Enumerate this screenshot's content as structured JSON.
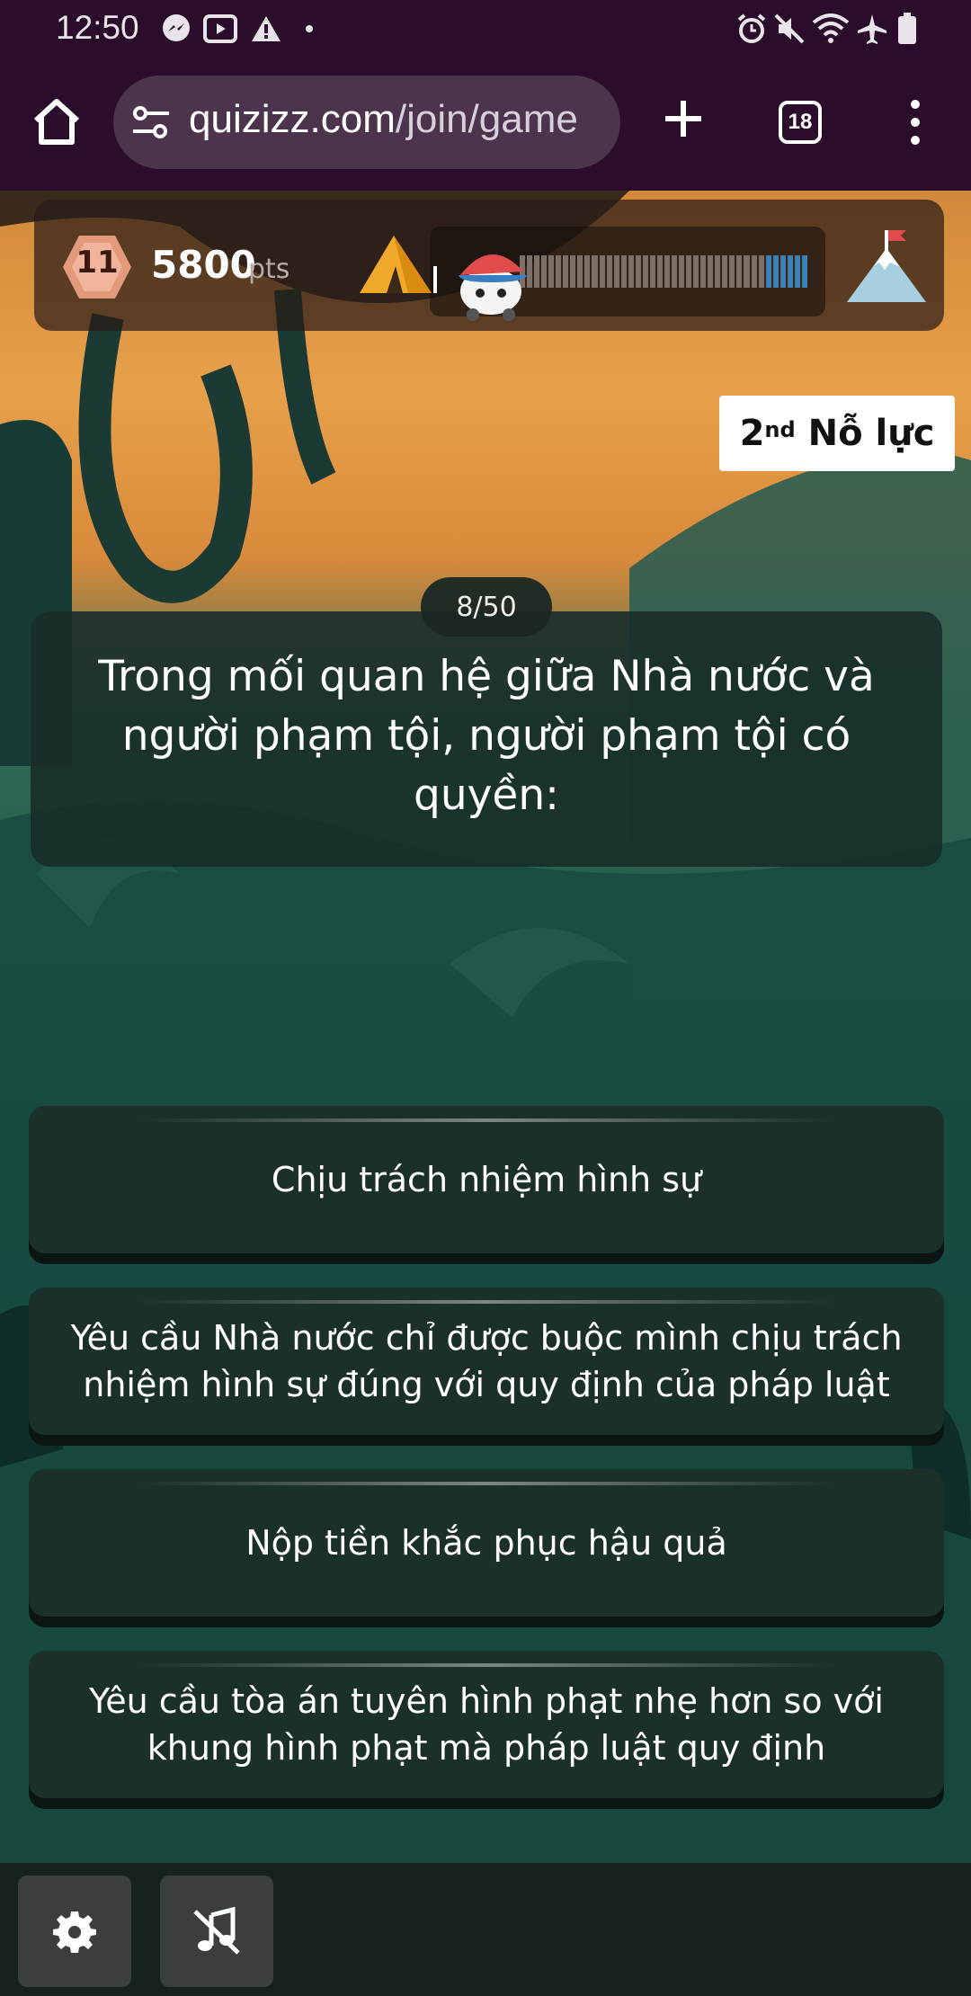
{
  "status_bar": {
    "time": "12:50",
    "left_icons": [
      "messenger-icon",
      "video-icon",
      "warning-icon",
      "dot-icon"
    ],
    "right_icons": [
      "alarm-icon",
      "mute-icon",
      "wifi-icon",
      "airplane-icon",
      "battery-icon"
    ]
  },
  "browser": {
    "url_domain": "quizizz.com",
    "url_path": "/join/game",
    "tab_count": "18",
    "icons": [
      "home-icon",
      "site-settings-icon",
      "new-tab-icon",
      "tabs-icon",
      "more-menu-icon"
    ]
  },
  "hud": {
    "level": "11",
    "points": "5800",
    "points_unit": "pts",
    "progress_fraction": 0.16,
    "icons": [
      "level-badge-icon",
      "tent-icon",
      "avatar-icon",
      "mountain-flag-icon"
    ]
  },
  "attempt": {
    "ordinal_num": "2",
    "ordinal_suffix": "nd",
    "label": "Nỗ lực"
  },
  "question": {
    "counter": "8/50",
    "text": "Trong mối quan hệ giữa Nhà nước và người phạm tội, người phạm tội có quyền:"
  },
  "answers": [
    "Chịu trách nhiệm hình sự",
    "Yêu cầu Nhà nước chỉ được buộc mình chịu trách nhiệm hình sự đúng với quy định của pháp luật",
    "Nộp tiền khắc phục hậu quả",
    "Yêu cầu tòa án tuyên hình phạt nhẹ hơn so với khung hình phạt mà pháp luật quy định"
  ],
  "bottom_bar": {
    "icons": [
      "settings-icon",
      "music-off-icon"
    ]
  }
}
